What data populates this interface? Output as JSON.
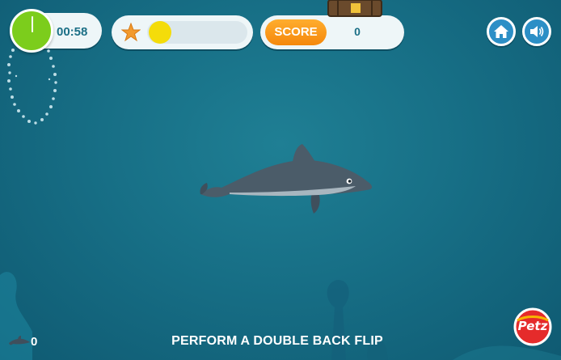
{
  "hud": {
    "timer": "00:58",
    "progress_fraction": 0.13,
    "score_label": "SCORE",
    "score_value": "0"
  },
  "icons": {
    "timer": "stopwatch-dial",
    "progress": "starfish-icon",
    "home": "home-icon",
    "sound": "speaker-icon",
    "lives": "dolphin-icon",
    "brand": "petz-logo"
  },
  "bottom": {
    "lives": "0",
    "instruction": "PERFORM A DOUBLE BACK FLIP"
  },
  "brand": {
    "logo_text": "Petz"
  },
  "colors": {
    "water": "#176f86",
    "timer_green": "#7ccd1c",
    "progress_yellow": "#f4dc0a",
    "score_orange": "#f5880c",
    "button_blue": "#2c8fc6"
  }
}
